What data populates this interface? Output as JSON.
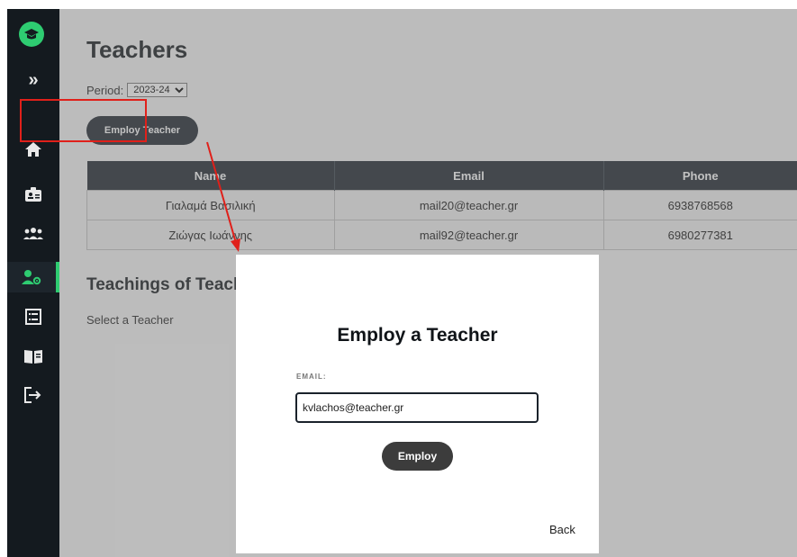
{
  "sidebar": {
    "logo": "graduation-cap-logo",
    "items": [
      {
        "name": "expand",
        "glyph": "»"
      },
      {
        "name": "home"
      },
      {
        "name": "id-card"
      },
      {
        "name": "users"
      },
      {
        "name": "teachers",
        "active": true
      },
      {
        "name": "list"
      },
      {
        "name": "book"
      },
      {
        "name": "logout"
      }
    ],
    "active_color": "#2ecc71"
  },
  "page": {
    "title": "Teachers",
    "period_label": "Period:",
    "period_value": "2023-24",
    "employ_button": "Employ Teacher"
  },
  "table": {
    "headers": [
      "Name",
      "Email",
      "Phone"
    ],
    "rows": [
      [
        "Γιαλαμά Βασιλική",
        "mail20@teacher.gr",
        "6938768568"
      ],
      [
        "Ζιώγας Ιωάννης",
        "mail92@teacher.gr",
        "6980277381"
      ]
    ]
  },
  "teachings": {
    "title": "Teachings of Teachers",
    "prompt": "Select a Teacher"
  },
  "modal": {
    "title": "Employ a Teacher",
    "email_label": "EMAIL:",
    "email_value": "kvlachos@teacher.gr",
    "employ_button": "Employ",
    "back_link": "Back"
  },
  "annotation": {
    "color": "#e0201a"
  }
}
